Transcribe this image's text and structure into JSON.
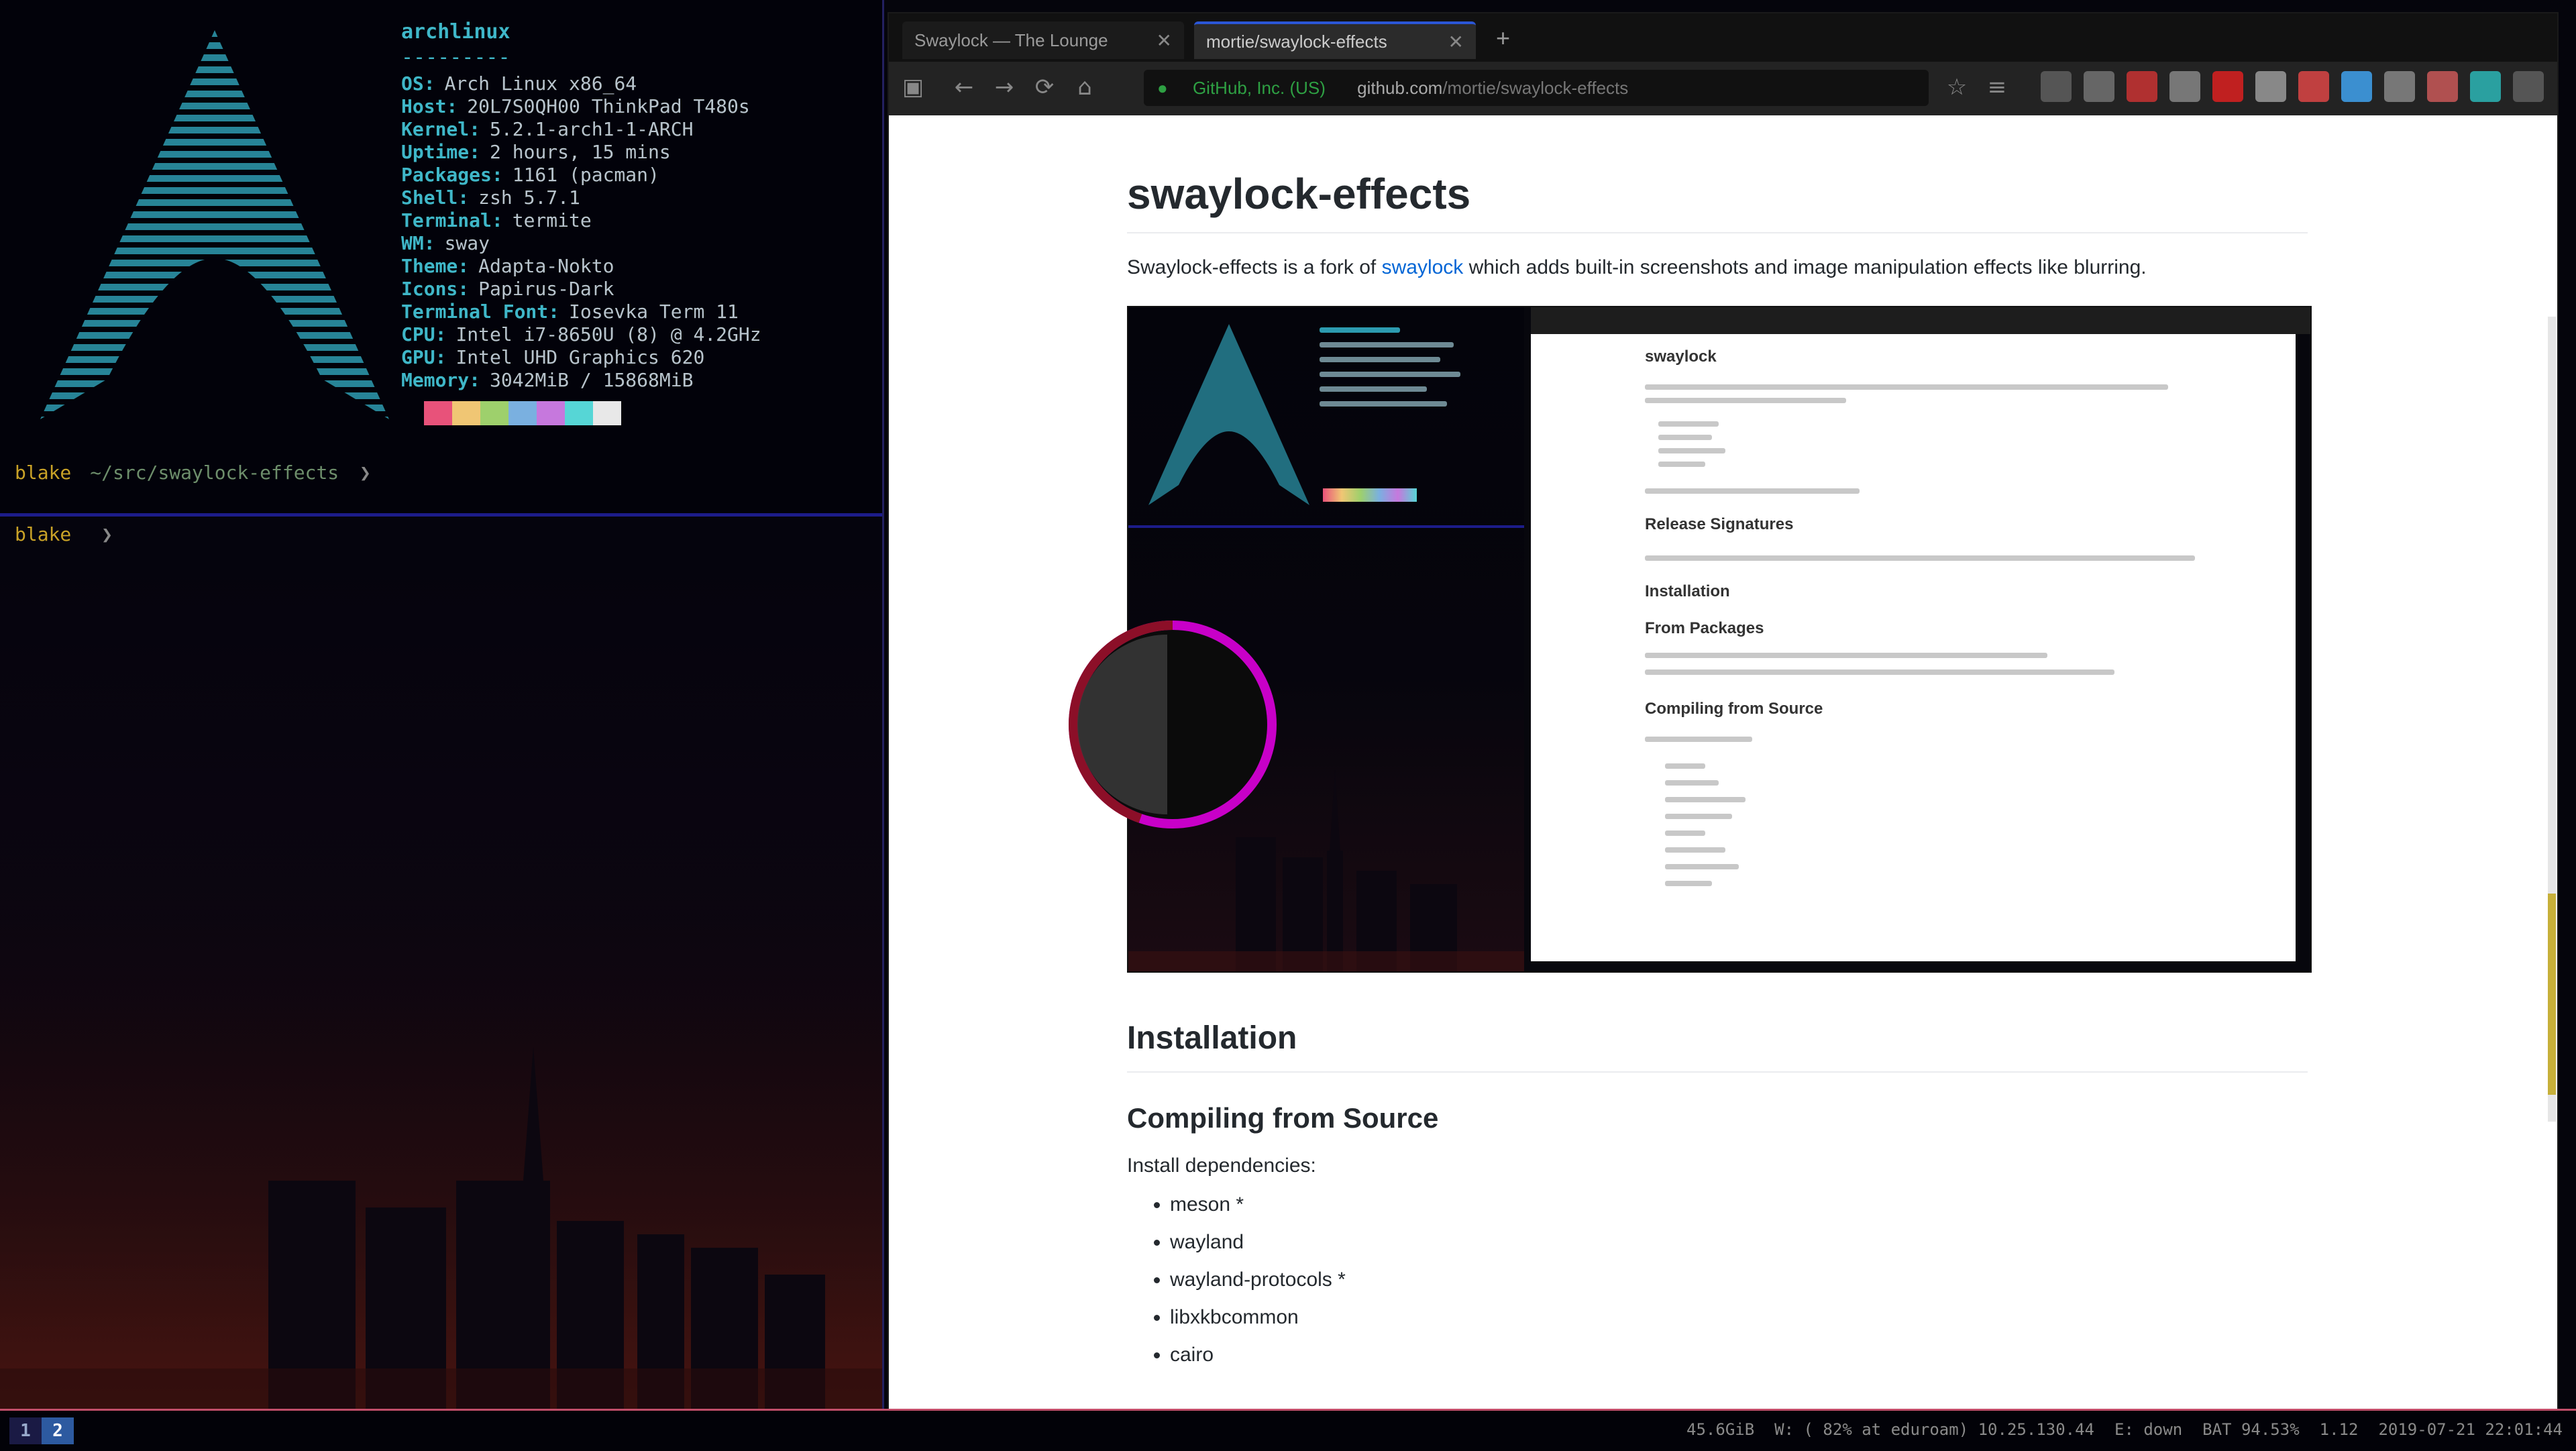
{
  "terminal": {
    "fetch_header": "archlinux",
    "fetch_separator": "---------",
    "fetch_lines": [
      {
        "key": "OS:",
        "value": "Arch Linux x86_64"
      },
      {
        "key": "Host:",
        "value": "20L7S0QH00 ThinkPad T480s"
      },
      {
        "key": "Kernel:",
        "value": "5.2.1-arch1-1-ARCH"
      },
      {
        "key": "Uptime:",
        "value": "2 hours, 15 mins"
      },
      {
        "key": "Packages:",
        "value": "1161 (pacman)"
      },
      {
        "key": "Shell:",
        "value": "zsh 5.7.1"
      },
      {
        "key": "Terminal:",
        "value": "termite"
      },
      {
        "key": "WM:",
        "value": "sway"
      },
      {
        "key": "Theme:",
        "value": "Adapta-Nokto"
      },
      {
        "key": "Icons:",
        "value": "Papirus-Dark"
      },
      {
        "key": "Terminal Font:",
        "value": "Iosevka Term 11"
      },
      {
        "key": "CPU:",
        "value": "Intel i7-8650U (8) @ 4.2GHz"
      },
      {
        "key": "GPU:",
        "value": "Intel UHD Graphics 620"
      },
      {
        "key": "Memory:",
        "value": "3042MiB / 15868MiB"
      }
    ],
    "palette": [
      "#e8527a",
      "#f0c674",
      "#9ed06c",
      "#7ab0e0",
      "#c678dd",
      "#56d6d6",
      "#e8e8e8"
    ],
    "prompts": [
      {
        "user": "blake",
        "path": "~/src/swaylock-effects",
        "symbol": "❯"
      },
      {
        "user": "blake",
        "path": "",
        "symbol": "❯"
      }
    ]
  },
  "browser": {
    "tabs": [
      {
        "title": "Swaylock — The Lounge",
        "active": false
      },
      {
        "title": "mortie/swaylock-effects",
        "active": true
      }
    ],
    "new_tab": "+",
    "url": {
      "secure_label": "GitHub, Inc. (US)",
      "domain": "github.com",
      "path": "/mortie/swaylock-effects"
    },
    "extension_colors": [
      "#555555",
      "#666666",
      "#b03030",
      "#777777",
      "#c02020",
      "#888888",
      "#c04040",
      "#3b8fd0",
      "#777777",
      "#b05050",
      "#2aa0a0",
      "#555555"
    ]
  },
  "article": {
    "title": "swaylock-effects",
    "intro_before": "Swaylock-effects is a fork of ",
    "intro_link": "swaylock",
    "intro_after": " which adds built-in screenshots and image manipulation effects like blurring.",
    "section_installation": "Installation",
    "section_compiling": "Compiling from Source",
    "deps_intro": "Install dependencies:",
    "dependencies": [
      "meson *",
      "wayland",
      "wayland-protocols *",
      "libxkbcommon",
      "cairo"
    ]
  },
  "embedded_screenshot": {
    "headings": [
      "swaylock",
      "Release Signatures",
      "Installation",
      "From Packages",
      "Compiling from Source"
    ]
  },
  "statusbar": {
    "workspaces": [
      "1",
      "2"
    ],
    "active_workspace": "2",
    "items": [
      "45.6GiB",
      "W: ( 82% at eduroam) 10.25.130.44",
      "E: down",
      "BAT 94.53%",
      "1.12",
      "2019-07-21 22:01:44"
    ]
  },
  "colors": {
    "indicator_ring": "#c800c8",
    "indicator_highlight": "#8c0f28",
    "accent_blue": "#2b56d6",
    "link": "#0366d6"
  }
}
